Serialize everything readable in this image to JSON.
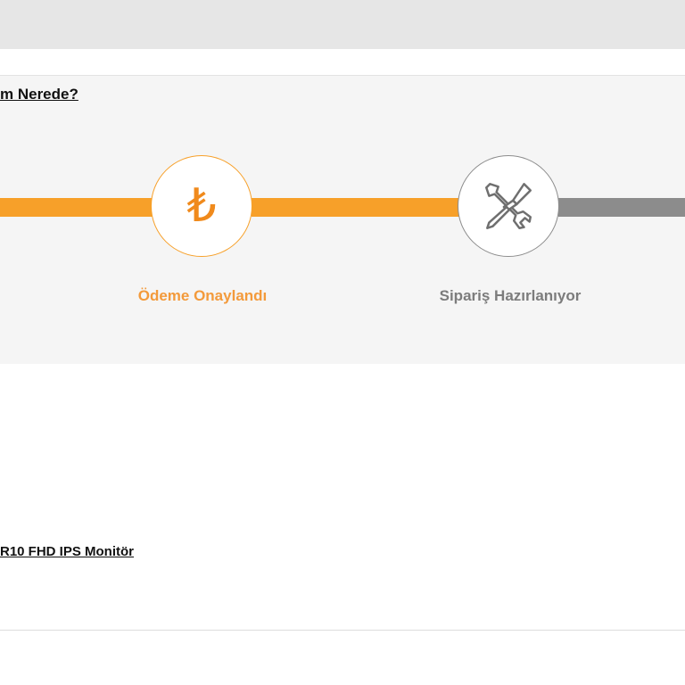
{
  "panel": {
    "title": "m Nerede?"
  },
  "steps": [
    {
      "icon": "lira-icon",
      "symbol": "₺",
      "label": "Ödeme Onaylandı",
      "state": "active"
    },
    {
      "icon": "tools-icon",
      "label": "Sipariş Hazırlanıyor",
      "state": "pending"
    }
  ],
  "product": {
    "name": "R10 FHD IPS Monitör"
  },
  "colors": {
    "accent": "#f7a029",
    "accent_text": "#f39a3b",
    "inactive": "#8c8c8c",
    "panel_bg": "#f5f5f5",
    "topbar_bg": "#e6e6e6"
  }
}
